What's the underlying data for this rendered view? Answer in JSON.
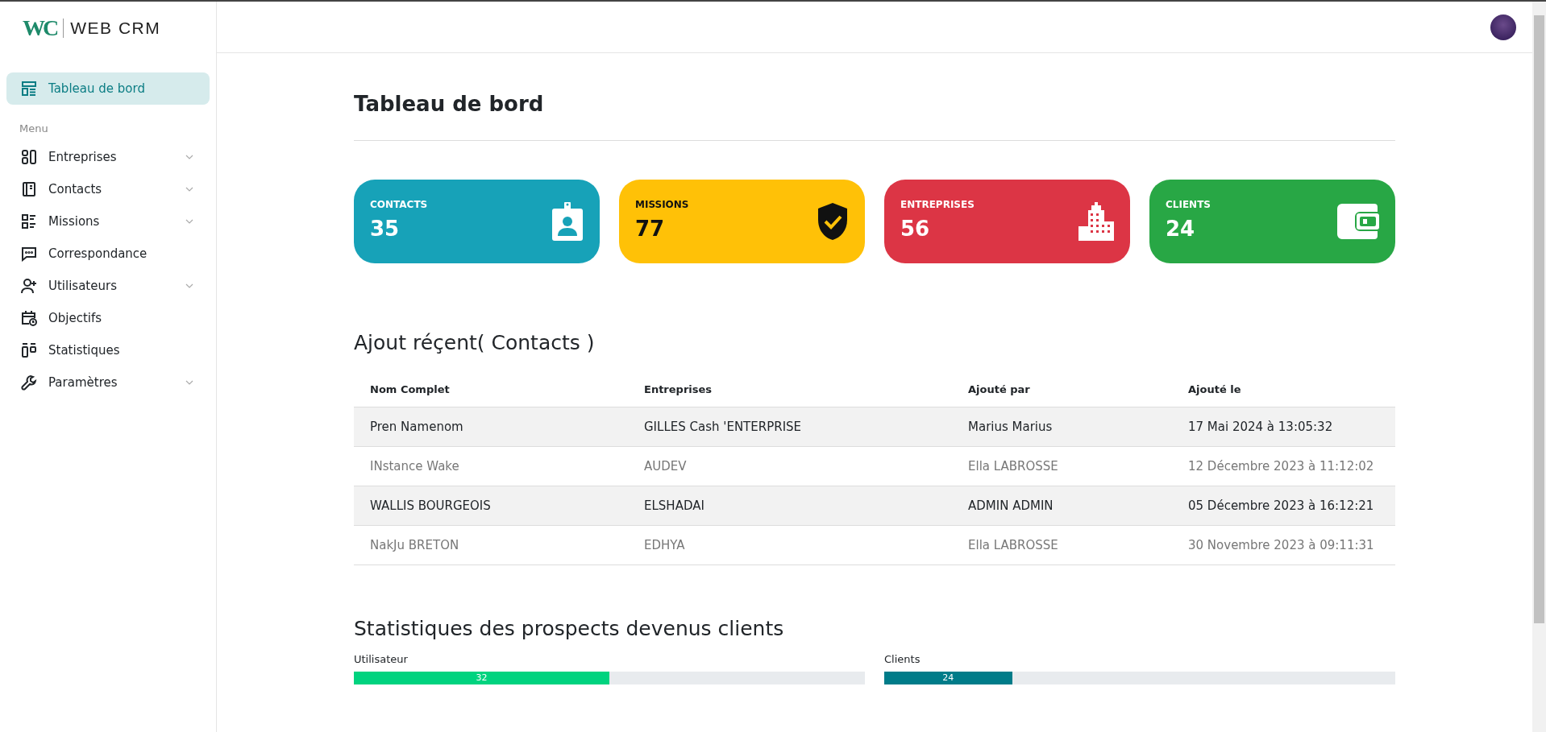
{
  "logo": {
    "mark": "WC",
    "name": "WEB CRM"
  },
  "sidebar": {
    "top_item": {
      "label": "Tableau de bord",
      "selected": true
    },
    "section_label": "Menu",
    "items": [
      {
        "label": "Entreprises",
        "expandable": true,
        "selected": false
      },
      {
        "label": "Contacts",
        "expandable": true,
        "selected": false
      },
      {
        "label": "Missions",
        "expandable": true,
        "selected": false
      },
      {
        "label": "Correspondance",
        "expandable": false,
        "selected": false
      },
      {
        "label": "Utilisateurs",
        "expandable": true,
        "selected": false
      },
      {
        "label": "Objectifs",
        "expandable": false,
        "selected": false
      },
      {
        "label": "Statistiques",
        "expandable": false,
        "selected": false
      },
      {
        "label": "Paramètres",
        "expandable": true,
        "selected": false
      }
    ]
  },
  "page_title": "Tableau de bord",
  "stat_cards": [
    {
      "label": "CONTACTS",
      "value": "35",
      "color": "#17a2b8",
      "dark_text": false
    },
    {
      "label": "MISSIONS",
      "value": "77",
      "color": "#ffc107",
      "dark_text": true
    },
    {
      "label": "ENTREPRISES",
      "value": "56",
      "color": "#dc3545",
      "dark_text": false
    },
    {
      "label": "CLIENTS",
      "value": "24",
      "color": "#28a745",
      "dark_text": false
    }
  ],
  "recent": {
    "title": "Ajout réçent( Contacts )",
    "table": {
      "columns": [
        "Nom Complet",
        "Entreprises",
        "Ajouté par",
        "Ajouté le"
      ],
      "rows": [
        {
          "shaded": true,
          "cells": [
            "Pren Namenom",
            "GILLES Cash 'ENTERPRISE",
            "Marius Marius",
            "17 Mai 2024 à 13:05:32"
          ]
        },
        {
          "shaded": false,
          "cells": [
            "INstance Wake",
            "AUDEV",
            "Ella LABROSSE",
            "12 Décembre 2023 à 11:12:02"
          ]
        },
        {
          "shaded": true,
          "cells": [
            "WALLIS BOURGEOIS",
            "ELSHADAI",
            "ADMIN ADMIN",
            "05 Décembre 2023 à 16:12:21"
          ]
        },
        {
          "shaded": false,
          "cells": [
            "NakJu BRETON",
            "EDHYA",
            "Ella LABROSSE",
            "30 Novembre 2023 à 09:11:31"
          ]
        }
      ]
    }
  },
  "prospects": {
    "title": "Statistiques des prospects devenus clients",
    "bars": [
      {
        "label": "Utilisateur",
        "value": "32",
        "level": 0.5,
        "color": "#00d37f"
      },
      {
        "label": "Clients",
        "value": "24",
        "level": 0.25,
        "color": "#007c89"
      }
    ]
  }
}
